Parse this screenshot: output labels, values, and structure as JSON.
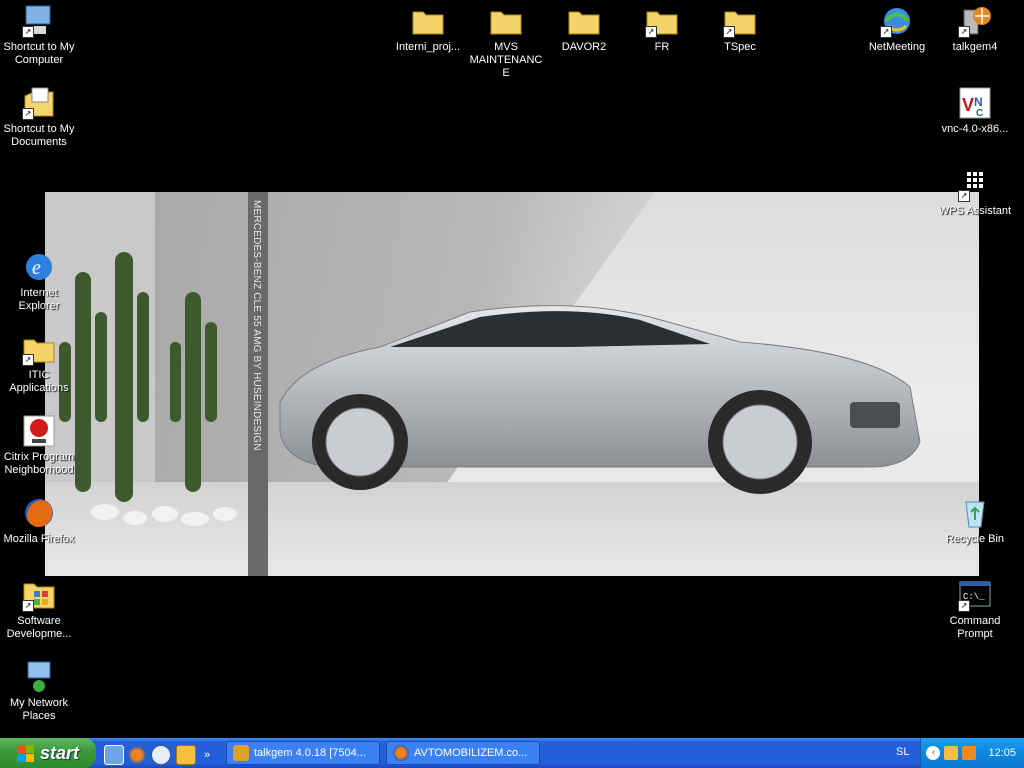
{
  "desktop": {
    "wallpaper_caption": "MERCEDES-BENZ CLE 55 AMG BY HUSEINDESIGN",
    "icons_left": [
      {
        "label": "Shortcut to My Computer",
        "icon": "my-computer-icon"
      },
      {
        "label": "Shortcut to My Documents",
        "icon": "my-documents-icon"
      },
      {
        "label": "Internet Explorer",
        "icon": "internet-explorer-icon"
      },
      {
        "label": "ITIC Applications",
        "icon": "folder-icon"
      },
      {
        "label": "Citrix Program Neighborhood",
        "icon": "citrix-icon"
      },
      {
        "label": "Mozilla Firefox",
        "icon": "firefox-icon"
      },
      {
        "label": "Software Developme...",
        "icon": "software-dev-icon"
      },
      {
        "label": "My Network Places",
        "icon": "network-places-icon"
      }
    ],
    "icons_top": [
      {
        "label": "Interni_proj...",
        "icon": "folder-icon"
      },
      {
        "label": "MVS MAINTENANCE",
        "icon": "folder-icon"
      },
      {
        "label": "DAVOR2",
        "icon": "folder-icon"
      },
      {
        "label": "FR",
        "icon": "folder-icon"
      },
      {
        "label": "TSpec",
        "icon": "folder-icon"
      },
      {
        "label": "NetMeeting",
        "icon": "netmeeting-icon"
      },
      {
        "label": "talkgem4",
        "icon": "talkgem-icon"
      }
    ],
    "icons_right": [
      {
        "label": "vnc-4.0-x86...",
        "icon": "vnc-icon"
      },
      {
        "label": "WPS Assistant",
        "icon": "wps-icon"
      },
      {
        "label": "Recycle Bin",
        "icon": "recycle-bin-icon"
      },
      {
        "label": "Command Prompt",
        "icon": "command-prompt-icon"
      }
    ]
  },
  "taskbar": {
    "start_label": "start",
    "quick_launch": [
      "desktop-icon",
      "firefox-icon",
      "media-player-icon",
      "clock-icon"
    ],
    "overflow": "»",
    "tasks": [
      {
        "label": "talkgem 4.0.18 [7504...",
        "icon": "talkgem-icon"
      },
      {
        "label": "AVTOMOBILIZEM.co...",
        "icon": "firefox-icon"
      }
    ],
    "language": "SL",
    "clock": "12:05"
  }
}
